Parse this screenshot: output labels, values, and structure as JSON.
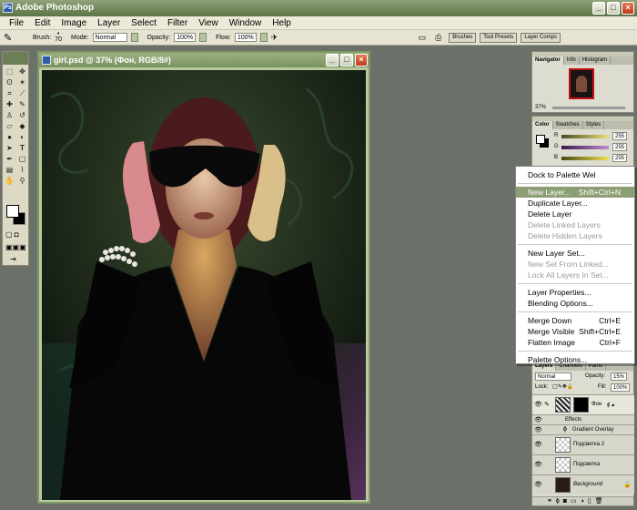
{
  "app": {
    "title": "Adobe Photoshop"
  },
  "menu": [
    "File",
    "Edit",
    "Image",
    "Layer",
    "Select",
    "Filter",
    "View",
    "Window",
    "Help"
  ],
  "options": {
    "brush_label": "Brush:",
    "brush_size": "70",
    "mode_label": "Mode:",
    "mode_value": "Normal",
    "opacity_label": "Opacity:",
    "opacity_value": "100%",
    "flow_label": "Flow:",
    "flow_value": "100%",
    "wells": [
      "Brushes",
      "Tool Presets",
      "Layer Comps"
    ]
  },
  "document": {
    "title": "girl.psd @ 37% (Фон, RGB/8#)"
  },
  "navigator": {
    "tabs": [
      "Navigator",
      "Info",
      "Histogram"
    ],
    "zoom": "37%"
  },
  "color_panel": {
    "tabs": [
      "Color",
      "Swatches",
      "Styles"
    ],
    "r_label": "R",
    "g_label": "G",
    "b_label": "B",
    "r": "255",
    "g": "255",
    "b": "255"
  },
  "context_menu": {
    "items": [
      {
        "label": "Dock to Palette Wel",
        "shortcut": "",
        "disabled": false
      },
      {
        "label": "New Layer...",
        "shortcut": "Shift+Ctrl+N",
        "disabled": false,
        "highlighted": true
      },
      {
        "label": "Duplicate Layer...",
        "shortcut": "",
        "disabled": false
      },
      {
        "label": "Delete Layer",
        "shortcut": "",
        "disabled": false
      },
      {
        "label": "Delete Linked Layers",
        "shortcut": "",
        "disabled": true
      },
      {
        "label": "Delete Hidden Layers",
        "shortcut": "",
        "disabled": true
      },
      {
        "label": "New Layer Set...",
        "shortcut": "",
        "disabled": false
      },
      {
        "label": "New Set From Linked...",
        "shortcut": "",
        "disabled": true
      },
      {
        "label": "Lock All Layers In Set...",
        "shortcut": "",
        "disabled": true
      },
      {
        "label": "Layer Properties...",
        "shortcut": "",
        "disabled": false
      },
      {
        "label": "Blending Options...",
        "shortcut": "",
        "disabled": false
      },
      {
        "label": "Merge Down",
        "shortcut": "Ctrl+E",
        "disabled": false
      },
      {
        "label": "Merge Visible",
        "shortcut": "Shift+Ctrl+E",
        "disabled": false
      },
      {
        "label": "Flatten Image",
        "shortcut": "Ctrl+F",
        "disabled": false
      },
      {
        "label": "Palette Options...",
        "shortcut": "",
        "disabled": false
      }
    ]
  },
  "layers": {
    "tabs": [
      "Layers",
      "Channels",
      "Paths"
    ],
    "mode": "Normal",
    "opacity_label": "Opacity:",
    "opacity": "15%",
    "lock_label": "Lock:",
    "fill_label": "Fill:",
    "fill": "100%",
    "items": [
      {
        "name": "Фон"
      },
      {
        "name": "Effects"
      },
      {
        "name": "Gradient Overlay"
      },
      {
        "name": "Подсветка 2"
      },
      {
        "name": "Подсветка"
      },
      {
        "name": "Background"
      }
    ]
  }
}
